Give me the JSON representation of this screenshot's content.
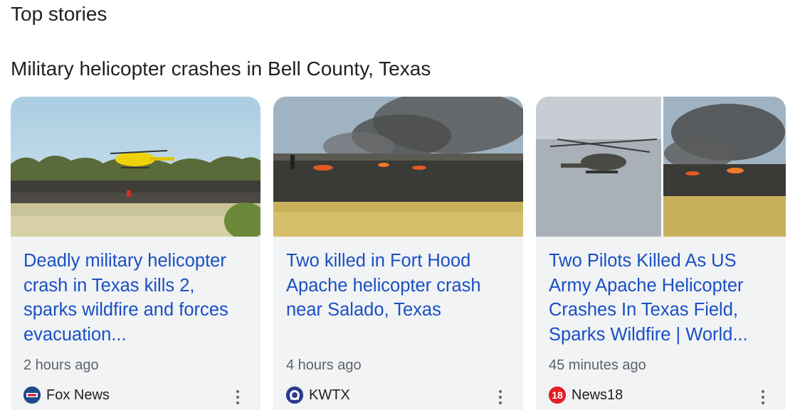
{
  "section_title": "Top stories",
  "topic_title": "Military helicopter crashes in Bell County, Texas",
  "cards": [
    {
      "headline": "Deadly military helicopter crash in Texas kills 2, sparks wildfire and forces evacuation...",
      "time": "2 hours ago",
      "source": "Fox News",
      "logo_icon": "fox-news-logo-icon",
      "logo_color": "#003366"
    },
    {
      "headline": "Two killed in Fort Hood Apache helicopter crash near Salado, Texas",
      "time": "4 hours ago",
      "source": "KWTX",
      "logo_icon": "kwtx-logo-icon",
      "logo_color": "#2a3a8c"
    },
    {
      "headline": "Two Pilots Killed As US Army Apache Helicopter Crashes In Texas Field, Sparks Wildfire | World...",
      "time": "45 minutes ago",
      "source": "News18",
      "logo_icon": "news18-logo-icon",
      "logo_text": "18",
      "logo_color": "#e31e24"
    }
  ],
  "colors": {
    "headline_link": "#1a4fc5",
    "card_background": "#f1f3f4",
    "secondary_text": "#5f6368"
  }
}
